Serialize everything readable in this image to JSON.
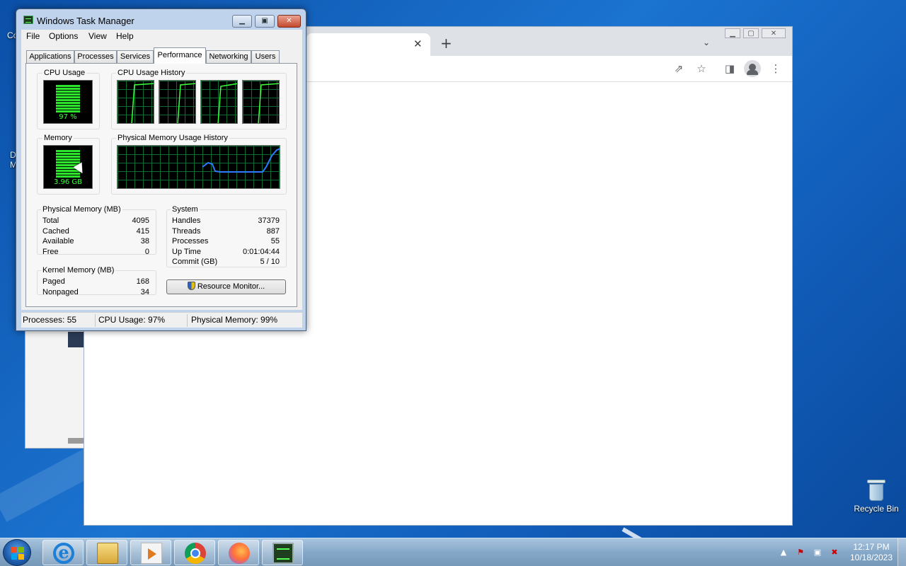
{
  "desktop": {
    "recycle_bin_label": "Recycle Bin",
    "peek_text_1": "Co",
    "peek_text_2": "D",
    "peek_text_3": "M"
  },
  "chrome": {
    "tab_close": "✕",
    "new_tab": "+",
    "tab_menu": "⌄",
    "share_icon": "⇗",
    "star_icon": "☆",
    "side_panel_icon": "◨",
    "menu_icon": "⋮"
  },
  "taskmgr": {
    "title": "Windows Task Manager",
    "menu": [
      "File",
      "Options",
      "View",
      "Help"
    ],
    "tabs": [
      "Applications",
      "Processes",
      "Services",
      "Performance",
      "Networking",
      "Users"
    ],
    "active_tab": "Performance",
    "cpu_usage_title": "CPU Usage",
    "cpu_usage_value": "97 %",
    "cpu_history_title": "CPU Usage History",
    "memory_title": "Memory",
    "memory_value": "3.96 GB",
    "phys_mem_history_title": "Physical Memory Usage History",
    "physical_memory": {
      "title": "Physical Memory (MB)",
      "rows": [
        {
          "label": "Total",
          "value": "4095"
        },
        {
          "label": "Cached",
          "value": "415"
        },
        {
          "label": "Available",
          "value": "38"
        },
        {
          "label": "Free",
          "value": "0"
        }
      ]
    },
    "kernel_memory": {
      "title": "Kernel Memory (MB)",
      "rows": [
        {
          "label": "Paged",
          "value": "168"
        },
        {
          "label": "Nonpaged",
          "value": "34"
        }
      ]
    },
    "system": {
      "title": "System",
      "rows": [
        {
          "label": "Handles",
          "value": "37379"
        },
        {
          "label": "Threads",
          "value": "887"
        },
        {
          "label": "Processes",
          "value": "55"
        },
        {
          "label": "Up Time",
          "value": "0:01:04:44"
        },
        {
          "label": "Commit (GB)",
          "value": "5 / 10"
        }
      ]
    },
    "resource_monitor_label": "Resource Monitor...",
    "status": {
      "processes": "Processes: 55",
      "cpu": "CPU Usage: 97%",
      "memory": "Physical Memory: 99%"
    },
    "cpu_meter_level": 0.97,
    "memory_meter_level": 0.99
  },
  "taskbar": {
    "apps": [
      "internet-explorer",
      "windows-explorer",
      "windows-media-player",
      "google-chrome",
      "firefox",
      "task-manager"
    ],
    "clock_time": "12:17 PM",
    "clock_date": "10/18/2023"
  }
}
